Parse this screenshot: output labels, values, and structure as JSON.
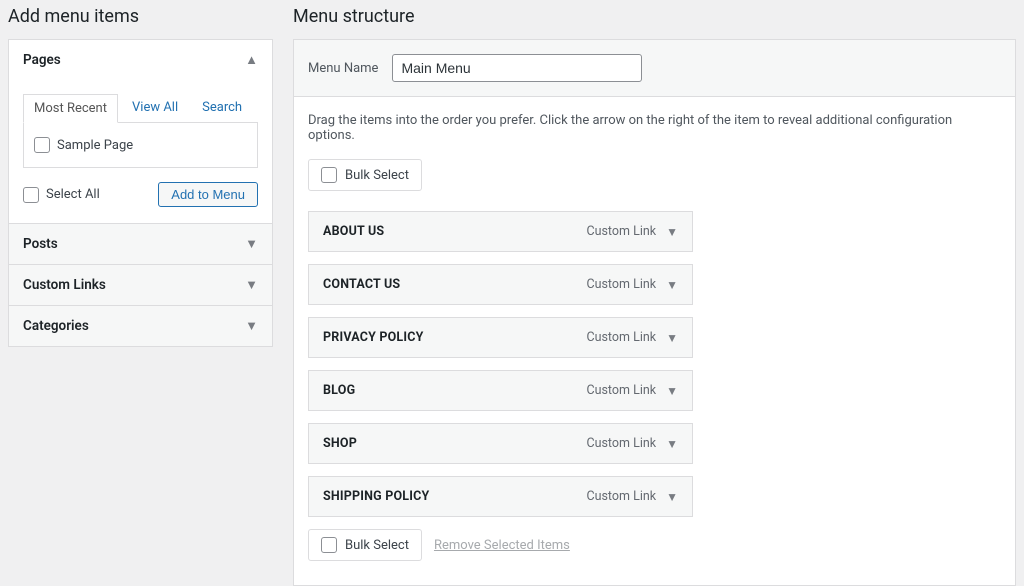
{
  "left": {
    "heading": "Add menu items",
    "panels": [
      {
        "label": "Pages",
        "open": true
      },
      {
        "label": "Posts",
        "open": false
      },
      {
        "label": "Custom Links",
        "open": false
      },
      {
        "label": "Categories",
        "open": false
      }
    ],
    "tabs": {
      "most_recent": "Most Recent",
      "view_all": "View All",
      "search": "Search"
    },
    "pages": {
      "sample_page": "Sample Page"
    },
    "select_all": "Select All",
    "add_to_menu": "Add to Menu"
  },
  "right": {
    "heading": "Menu structure",
    "menu_name_label": "Menu Name",
    "menu_name_value": "Main Menu",
    "hint": "Drag the items into the order you prefer. Click the arrow on the right of the item to reveal additional configuration options.",
    "bulk_select": "Bulk Select",
    "remove_selected": "Remove Selected Items",
    "item_type": "Custom Link",
    "items": [
      {
        "title": "ABOUT US"
      },
      {
        "title": "CONTACT US"
      },
      {
        "title": "PRIVACY POLICY"
      },
      {
        "title": "BLOG"
      },
      {
        "title": "SHOP"
      },
      {
        "title": "SHIPPING POLICY"
      }
    ]
  }
}
